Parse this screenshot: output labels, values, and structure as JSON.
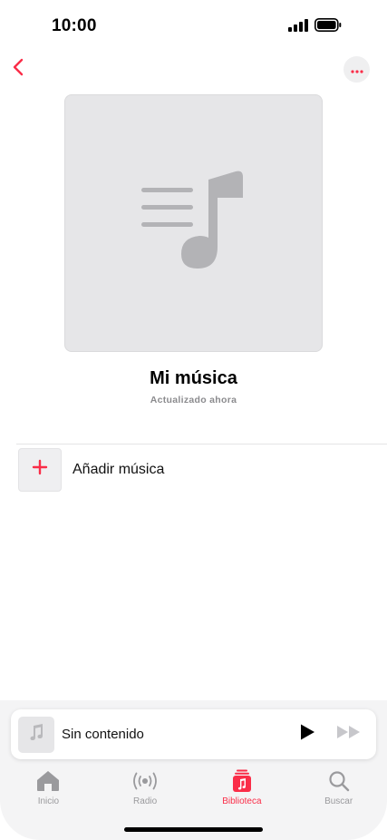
{
  "status_bar": {
    "time": "10:00",
    "icons": [
      "cellular-signal-icon",
      "battery-icon"
    ]
  },
  "nav": {
    "back_icon": "chevron-left-icon",
    "more_icon": "ellipsis-icon"
  },
  "playlist": {
    "artwork_icon": "music-list-icon",
    "title": "Mi música",
    "subtitle": "Actualizado ahora"
  },
  "add_music": {
    "icon": "plus-icon",
    "label": "Añadir música"
  },
  "mini_player": {
    "artwork_icon": "music-note-icon",
    "title": "Sin contenido",
    "play_icon": "play-icon",
    "forward_icon": "fast-forward-icon"
  },
  "tabs": [
    {
      "label": "Inicio",
      "icon": "home-icon",
      "active": false
    },
    {
      "label": "Radio",
      "icon": "radio-icon",
      "active": false
    },
    {
      "label": "Biblioteca",
      "icon": "library-icon",
      "active": true
    },
    {
      "label": "Buscar",
      "icon": "search-icon",
      "active": false
    }
  ],
  "colors": {
    "accent": "#fa2d48",
    "inactive": "#9a9a9d",
    "artwork_placeholder": "#e6e6e8",
    "artwork_glyph": "#b3b3b6"
  }
}
